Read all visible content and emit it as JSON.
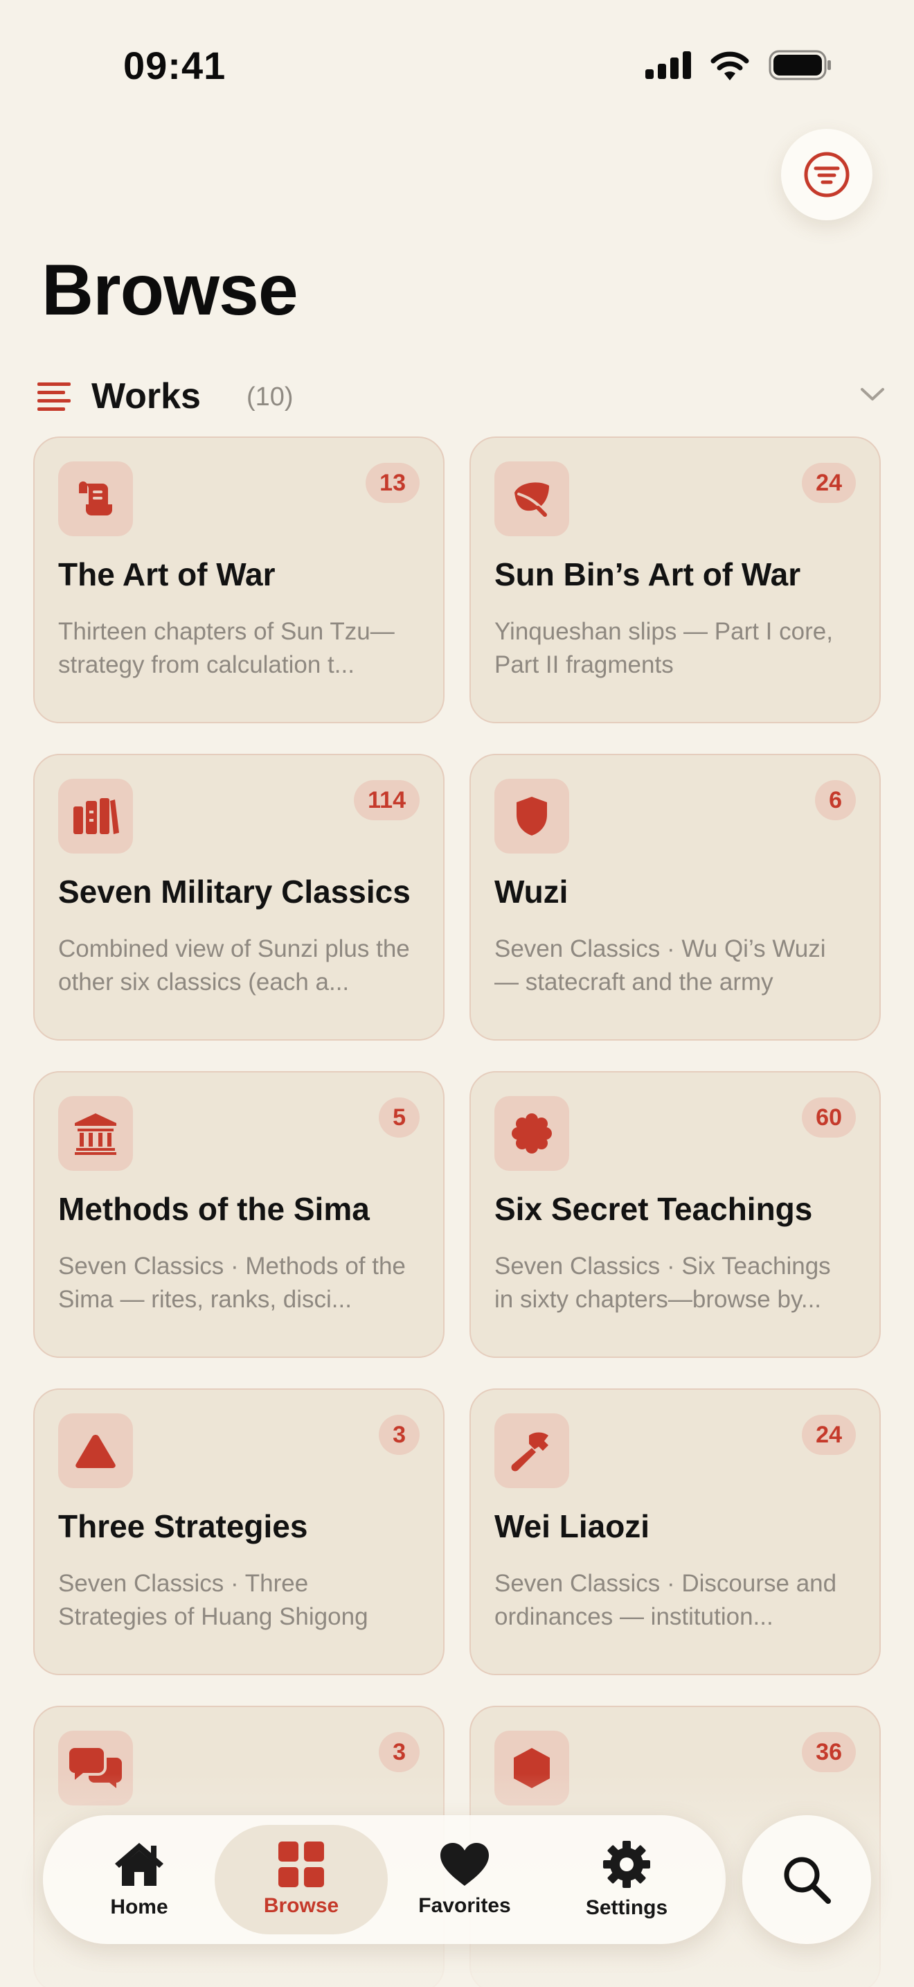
{
  "status": {
    "time": "09:41"
  },
  "header": {
    "title": "Browse"
  },
  "section": {
    "title": "Works",
    "count": "(10)"
  },
  "accent_color": "#c53a2b",
  "cards": [
    {
      "icon": "scroll-icon",
      "title": "The Art of War",
      "badge": "13",
      "description": "Thirteen chapters of Sun Tzu—strategy from calculation t..."
    },
    {
      "icon": "leaf-icon",
      "title": "Sun Bin’s Art of War",
      "badge": "24",
      "description": "Yinqueshan slips — Part I core, Part II fragments"
    },
    {
      "icon": "books-icon",
      "title": "Seven Military Classics",
      "badge": "114",
      "description": "Combined view of Sunzi plus the other six classics (each a..."
    },
    {
      "icon": "shield-icon",
      "title": "Wuzi",
      "badge": "6",
      "description": "Seven Classics · Wu Qi’s Wuzi — statecraft and the army"
    },
    {
      "icon": "building-columns-icon",
      "title": "Methods of the Sima",
      "badge": "5",
      "description": "Seven Classics · Methods of the Sima — rites, ranks, disci..."
    },
    {
      "icon": "seal-icon",
      "title": "Six Secret Teachings",
      "badge": "60",
      "description": "Seven Classics · Six Teachings in sixty chapters—browse by..."
    },
    {
      "icon": "triangle-icon",
      "title": "Three Strategies",
      "badge": "3",
      "description": "Seven Classics · Three Strategies of Huang Shigong"
    },
    {
      "icon": "hammer-icon",
      "title": "Wei Liaozi",
      "badge": "24",
      "description": "Seven Classics · Discourse and ordinances — institution..."
    },
    {
      "icon": "speech-bubbles-icon",
      "title": "",
      "badge": "3",
      "description": ""
    },
    {
      "icon": "hexagon-icon",
      "title": "",
      "badge": "36",
      "description": ""
    }
  ],
  "tabs": [
    {
      "label": "Home",
      "icon": "house-icon"
    },
    {
      "label": "Browse",
      "icon": "grid-icon",
      "active": true
    },
    {
      "label": "Favorites",
      "icon": "heart-icon"
    },
    {
      "label": "Settings",
      "icon": "gear-icon"
    }
  ],
  "search": {
    "icon": "search-icon"
  }
}
